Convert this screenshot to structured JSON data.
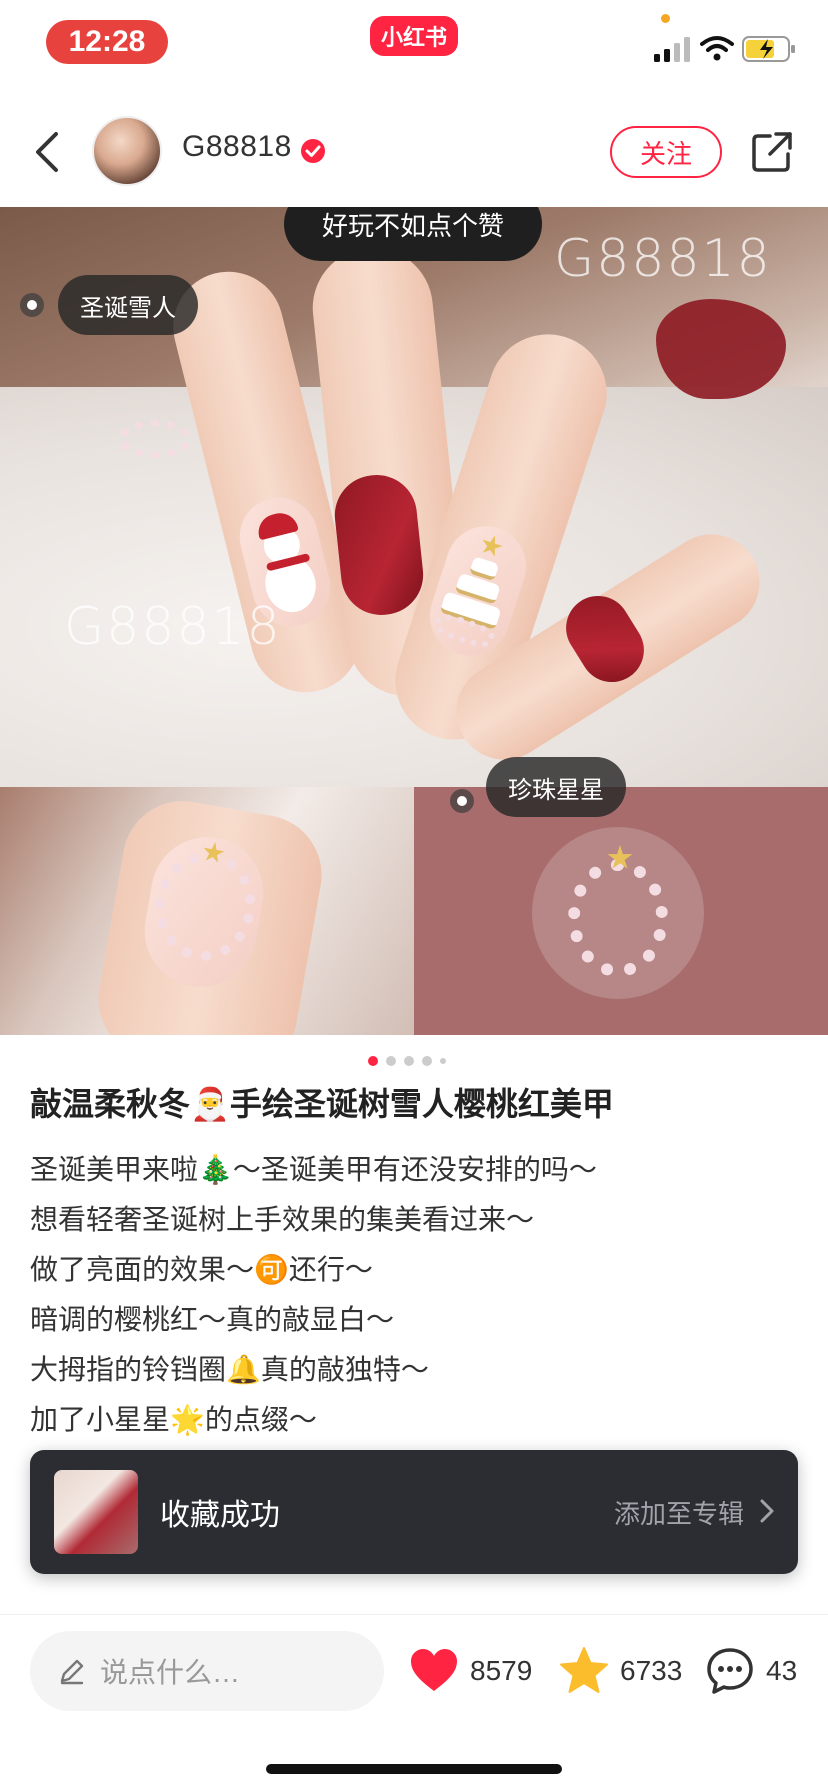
{
  "status_bar": {
    "time": "12:28",
    "app_badge": "小红书",
    "accent": "#ff2442"
  },
  "header": {
    "author_name": "G88818",
    "follow_label": "关注"
  },
  "image": {
    "like_tip": "好玩不如点个赞",
    "tags": [
      "圣诞雪人",
      "珍珠星星"
    ],
    "watermark": "G88818",
    "page_count": 5,
    "active_page": 1
  },
  "post": {
    "title": "敲温柔秋冬🎅手绘圣诞树雪人樱桃红美甲",
    "lines": [
      "圣诞美甲来啦🎄～圣诞美甲有还没安排的吗～",
      "想看轻奢圣诞树上手效果的集美看过来～",
      "做了亮面的效果～🉑还行～",
      "暗调的樱桃红～真的敲显白～",
      "大拇指的铃铛圈🔔真的敲独特～",
      "加了小星星🌟的点缀～"
    ]
  },
  "toast": {
    "message": "收藏成功",
    "action": "添加至专辑"
  },
  "bottom_bar": {
    "comment_placeholder": "说点什么…",
    "likes": "8579",
    "collects": "6733",
    "comments": "43",
    "like_color": "#ff2442",
    "collect_color": "#fcbd2c"
  }
}
